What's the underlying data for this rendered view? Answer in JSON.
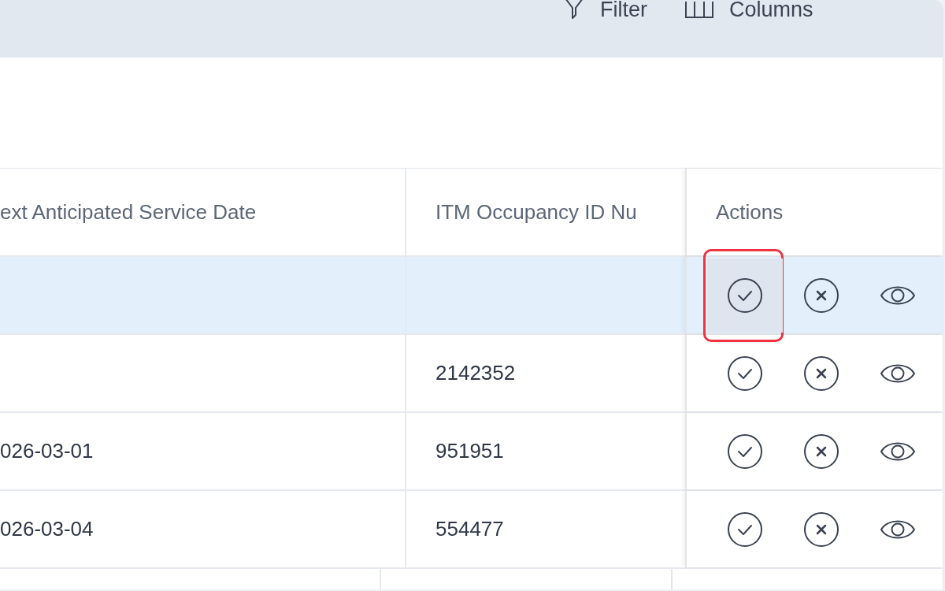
{
  "toolbar": {
    "buttons": [
      {
        "kind": "filter",
        "label": "Filter"
      },
      {
        "kind": "columns",
        "label": "Columns"
      }
    ]
  },
  "table": {
    "columns": [
      "ext Anticipated Service Date",
      "ITM Occupancy ID Nu",
      "Actions"
    ],
    "rows": [
      {
        "selected": true,
        "cells": [
          "",
          ""
        ],
        "actions": [
          {
            "kind": "approve",
            "highlighted": true
          },
          {
            "kind": "reject",
            "highlighted": false
          },
          {
            "kind": "view",
            "highlighted": false
          }
        ]
      },
      {
        "selected": false,
        "cells": [
          "",
          "2142352"
        ],
        "actions": [
          {
            "kind": "approve",
            "highlighted": false
          },
          {
            "kind": "reject",
            "highlighted": false
          },
          {
            "kind": "view",
            "highlighted": false
          }
        ]
      },
      {
        "selected": false,
        "cells": [
          "026-03-01",
          "951951"
        ],
        "actions": [
          {
            "kind": "approve",
            "highlighted": false
          },
          {
            "kind": "reject",
            "highlighted": false
          },
          {
            "kind": "view",
            "highlighted": false
          }
        ]
      },
      {
        "selected": false,
        "cells": [
          "026-03-04",
          "554477"
        ],
        "actions": [
          {
            "kind": "approve",
            "highlighted": false
          },
          {
            "kind": "reject",
            "highlighted": false
          },
          {
            "kind": "view",
            "highlighted": false
          }
        ]
      }
    ]
  }
}
